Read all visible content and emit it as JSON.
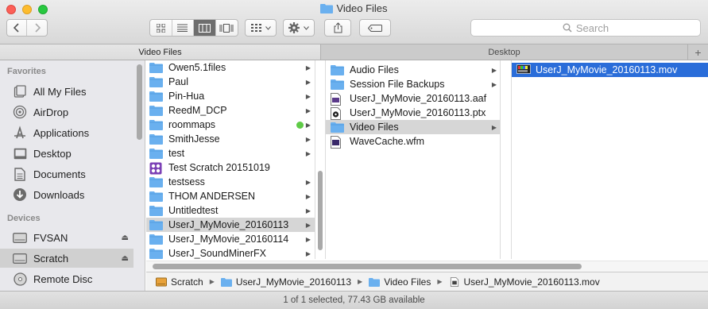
{
  "window": {
    "title": "Video Files"
  },
  "toolbar": {
    "search_placeholder": "Search",
    "arrange_icon": "grid-arrange-icon",
    "action_icon": "gear-icon",
    "share_icon": "share-icon",
    "tag_icon": "tag-icon"
  },
  "tabs": [
    {
      "label": "Video Files",
      "active": true
    },
    {
      "label": "Desktop",
      "active": false
    }
  ],
  "sidebar": {
    "favorites_header": "Favorites",
    "favorites": [
      {
        "label": "All My Files",
        "icon": "all-files-icon"
      },
      {
        "label": "AirDrop",
        "icon": "airdrop-icon"
      },
      {
        "label": "Applications",
        "icon": "applications-icon"
      },
      {
        "label": "Desktop",
        "icon": "desktop-icon"
      },
      {
        "label": "Documents",
        "icon": "documents-icon"
      },
      {
        "label": "Downloads",
        "icon": "downloads-icon"
      }
    ],
    "devices_header": "Devices",
    "devices": [
      {
        "label": "FVSAN",
        "icon": "drive-icon",
        "eject": true,
        "selected": false
      },
      {
        "label": "Scratch",
        "icon": "drive-icon",
        "eject": true,
        "selected": true
      },
      {
        "label": "Remote Disc",
        "icon": "disc-icon",
        "eject": false,
        "selected": false
      }
    ]
  },
  "column1": [
    {
      "label": "Owen5.1files",
      "type": "folder",
      "arrow": true
    },
    {
      "label": "Paul",
      "type": "folder",
      "arrow": true
    },
    {
      "label": "Pin-Hua",
      "type": "folder",
      "arrow": true
    },
    {
      "label": "ReedM_DCP",
      "type": "folder",
      "arrow": true
    },
    {
      "label": "roommaps",
      "type": "folder",
      "arrow": true,
      "tag": "#5fcb47"
    },
    {
      "label": "SmithJesse",
      "type": "folder",
      "arrow": true
    },
    {
      "label": "test",
      "type": "folder",
      "arrow": true
    },
    {
      "label": "Test Scratch 20151019",
      "type": "app",
      "arrow": false
    },
    {
      "label": "testsess",
      "type": "folder",
      "arrow": true
    },
    {
      "label": "THOM ANDERSEN",
      "type": "folder",
      "arrow": true
    },
    {
      "label": "Untitledtest",
      "type": "folder",
      "arrow": true
    },
    {
      "label": "UserJ_MyMovie_20160113",
      "type": "folder",
      "arrow": true,
      "selected": true
    },
    {
      "label": "UserJ_MyMovie_20160114",
      "type": "folder",
      "arrow": true
    },
    {
      "label": "UserJ_SoundMinerFX",
      "type": "folder",
      "arrow": true
    }
  ],
  "column2": [
    {
      "label": "Audio Files",
      "type": "folder",
      "arrow": true
    },
    {
      "label": "Session File Backups",
      "type": "folder",
      "arrow": true
    },
    {
      "label": "UserJ_MyMovie_20160113.aaf",
      "type": "aaf",
      "arrow": false
    },
    {
      "label": "UserJ_MyMovie_20160113.ptx",
      "type": "ptx",
      "arrow": false
    },
    {
      "label": "Video Files",
      "type": "folder",
      "arrow": true,
      "selected": true
    },
    {
      "label": "WaveCache.wfm",
      "type": "wfm",
      "arrow": false
    }
  ],
  "column3": [
    {
      "label": "UserJ_MyMovie_20160113.mov",
      "type": "mov",
      "selected": true
    }
  ],
  "pathbar": [
    {
      "label": "Scratch",
      "icon": "drive-icon"
    },
    {
      "label": "UserJ_MyMovie_20160113",
      "icon": "folder-icon"
    },
    {
      "label": "Video Files",
      "icon": "folder-icon"
    },
    {
      "label": "UserJ_MyMovie_20160113.mov",
      "icon": "movie-file-icon"
    }
  ],
  "status": {
    "text": "1 of 1 selected, 77.43 GB available"
  },
  "colors": {
    "selection_blue": "#2a6dd9",
    "folder_blue": "#6ab0ef",
    "tag_green": "#5fcb47"
  }
}
